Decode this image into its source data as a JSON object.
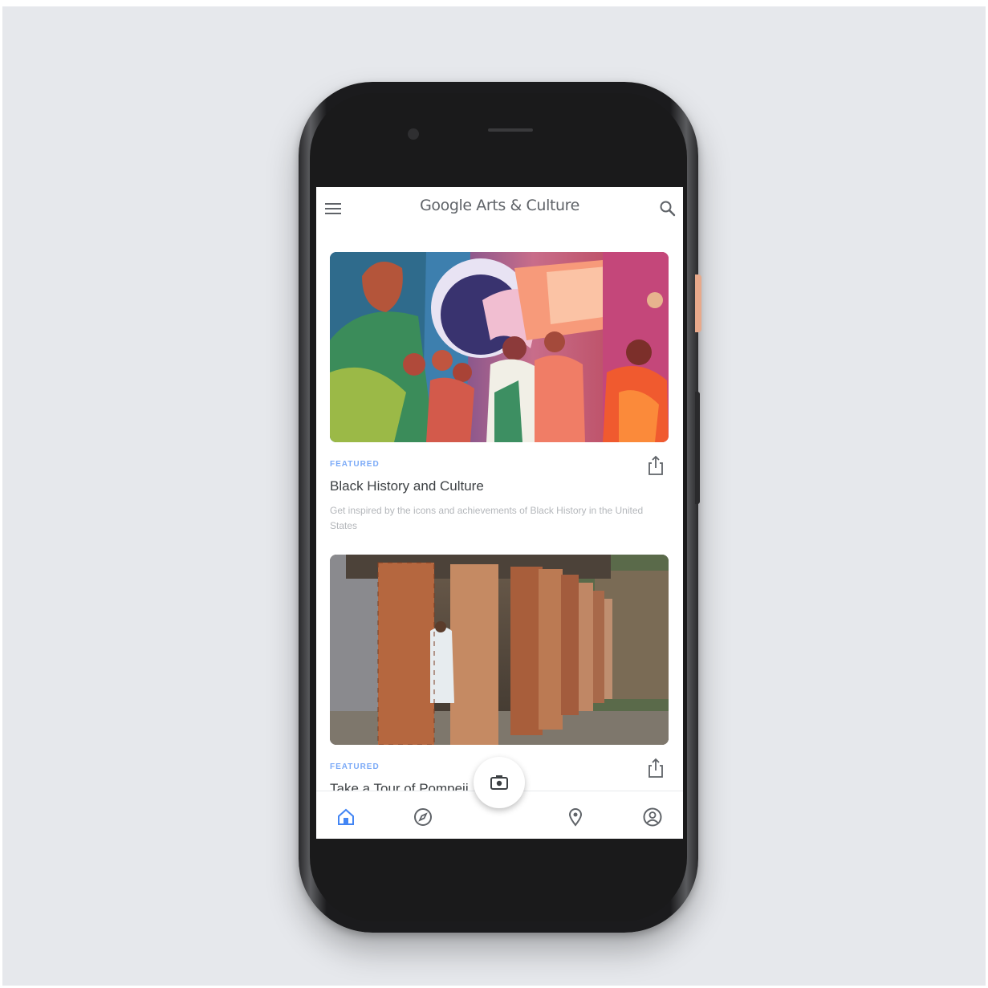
{
  "app": {
    "title": "Google Arts & Culture"
  },
  "header": {
    "menu_icon": "menu-icon",
    "search_icon": "search-icon"
  },
  "feed": {
    "cards": [
      {
        "tag": "FEATURED",
        "title": "Black History and Culture",
        "description": "Get inspired by the icons and achievements of Black History in the United States",
        "share_icon": "share-icon"
      },
      {
        "tag": "FEATURED",
        "title": "Take a Tour of Pompeii",
        "description": "",
        "share_icon": "share-icon"
      }
    ]
  },
  "bottom_nav": {
    "items": [
      {
        "icon": "home-icon",
        "active": true
      },
      {
        "icon": "explore-icon",
        "active": false
      },
      {
        "icon": "camera-icon",
        "active": false
      },
      {
        "icon": "location-icon",
        "active": false
      },
      {
        "icon": "profile-icon",
        "active": false
      }
    ]
  },
  "colors": {
    "accent": "#4285f4",
    "tag": "#7baaf7",
    "title_text": "#3c4043",
    "secondary_text": "#b4b7bb",
    "icon": "#5f6368",
    "background": "#e6e8ec"
  }
}
